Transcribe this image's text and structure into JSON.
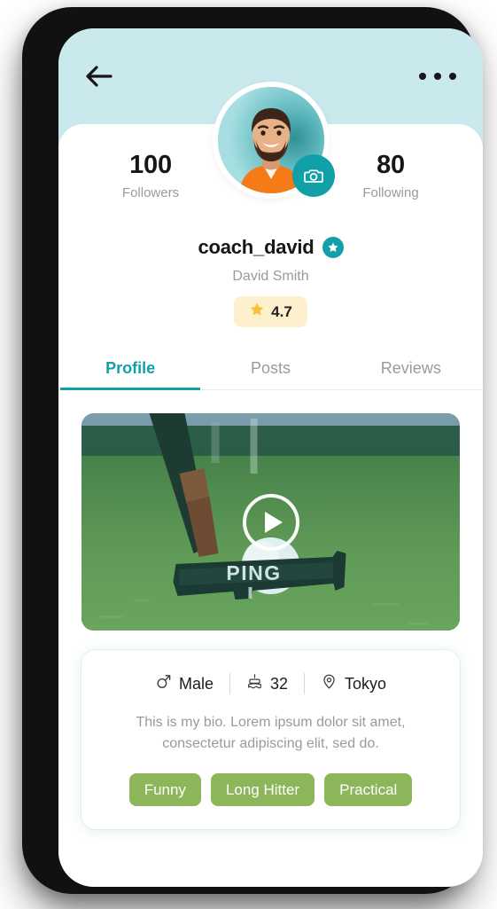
{
  "theme": {
    "header_bg": "#c9e9ec",
    "accent": "#12a0a8",
    "tag_green": "#8db55a",
    "rating_bg": "#fdf0cd",
    "star_gold": "#f5c23a",
    "muted_text": "#9b9b9b"
  },
  "topbar": {
    "back_icon": "arrow-left-icon",
    "more_icon": "more-horizontal-icon"
  },
  "profile": {
    "avatar_alt": "coach_david profile photo",
    "camera_icon": "camera-icon",
    "verified_icon": "verified-star-icon",
    "username": "coach_david",
    "fullname": "David Smith",
    "rating": "4.7",
    "rating_star_icon": "star-icon",
    "stats": [
      {
        "value": "100",
        "label": "Followers"
      },
      {
        "value": "80",
        "label": "Following"
      }
    ]
  },
  "tabs": [
    {
      "label": "Profile",
      "active": true
    },
    {
      "label": "Posts",
      "active": false
    },
    {
      "label": "Reviews",
      "active": false
    }
  ],
  "video": {
    "play_icon": "play-icon",
    "brand_text": "PING",
    "alt": "golf putter and ball on green"
  },
  "bio": {
    "meta": [
      {
        "icon": "male-gender-icon",
        "text": "Male"
      },
      {
        "icon": "birthday-cake-icon",
        "text": "32"
      },
      {
        "icon": "location-pin-icon",
        "text": "Tokyo"
      }
    ],
    "text": "This is my bio. Lorem ipsum dolor sit amet, consectetur adipiscing elit, sed do.",
    "tags": [
      "Funny",
      "Long Hitter",
      "Practical"
    ]
  }
}
